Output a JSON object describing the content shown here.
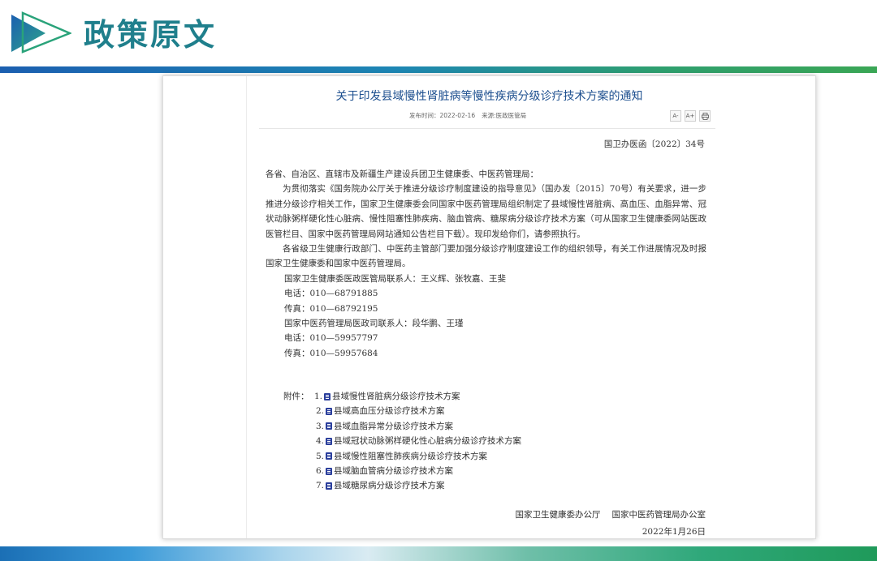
{
  "header": {
    "title": "政策原文",
    "colors": {
      "title": "#1f7f8c",
      "band_start": "#1b5fb0",
      "band_end": "#3aa655"
    }
  },
  "document": {
    "title": "关于印发县域慢性肾脏病等慢性疾病分级诊疗技术方案的通知",
    "publish_label": "发布时间：",
    "publish_date": "2022-02-16",
    "source_label": "来源:",
    "source_value": "医政医管局",
    "tools": {
      "font_small": "A-",
      "font_large": "A+",
      "print": "print-icon"
    },
    "doc_number": "国卫办医函〔2022〕34号",
    "salutation": "各省、自治区、直辖市及新疆生产建设兵团卫生健康委、中医药管理局：",
    "paragraph1": "为贯彻落实《国务院办公厅关于推进分级诊疗制度建设的指导意见》（国办发〔2015〕70号）有关要求，进一步推进分级诊疗相关工作，国家卫生健康委会同国家中医药管理局组织制定了县域慢性肾脏病、高血压、血脂异常、冠状动脉粥样硬化性心脏病、慢性阻塞性肺疾病、脑血管病、糖尿病分级诊疗技术方案（可从国家卫生健康委网站医政医管栏目、国家中医药管理局网站通知公告栏目下载）。现印发给你们，请参照执行。",
    "paragraph2": "各省级卫生健康行政部门、中医药主管部门要加强分级诊疗制度建设工作的组织领导，有关工作进展情况及时报国家卫生健康委和国家中医药管理局。",
    "contacts": [
      "国家卫生健康委医政医管局联系人：王义辉、张牧嘉、王斐",
      "电话：010—68791885",
      "传真：010—68792195",
      "国家中医药管理局医政司联系人：段华鹏、王瑾",
      "电话：010—59957797",
      "传真：010—59957684"
    ],
    "attachments_label": "附件：",
    "attachments": [
      {
        "num": "1.",
        "name": "县域慢性肾脏病分级诊疗技术方案"
      },
      {
        "num": "2.",
        "name": "县域高血压分级诊疗技术方案"
      },
      {
        "num": "3.",
        "name": "县域血脂异常分级诊疗技术方案"
      },
      {
        "num": "4.",
        "name": "县域冠状动脉粥样硬化性心脏病分级诊疗技术方案"
      },
      {
        "num": "5.",
        "name": "县域慢性阻塞性肺疾病分级诊疗技术方案"
      },
      {
        "num": "6.",
        "name": "县域脑血管病分级诊疗技术方案"
      },
      {
        "num": "7.",
        "name": "县域糖尿病分级诊疗技术方案"
      }
    ],
    "signer1": "国家卫生健康委办公厅",
    "signer2": "国家中医药管理局办公室",
    "sign_date": "2022年1月26日"
  }
}
